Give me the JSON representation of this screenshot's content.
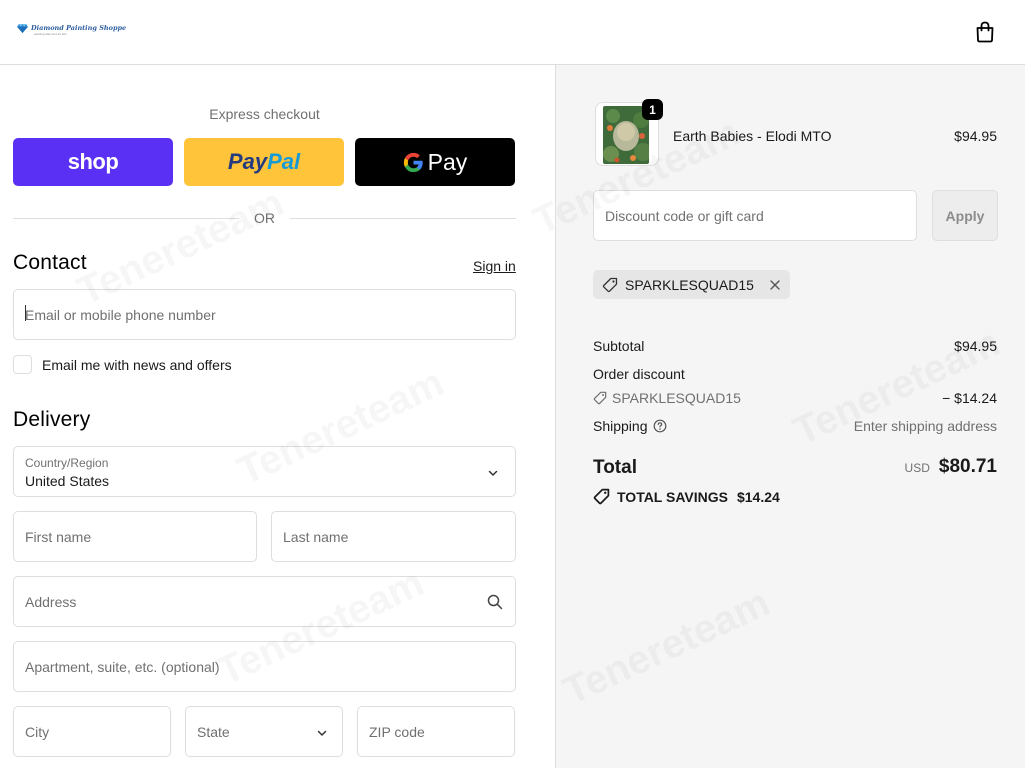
{
  "header": {
    "brand_name": "Diamond Painting Shoppe",
    "brand_tagline": "painting diamond art kits",
    "icons": {
      "brand": "diamond-icon",
      "cart": "shopping-bag-icon"
    }
  },
  "checkout": {
    "express_title": "Express checkout",
    "shop_pay_label": "shop",
    "paypal_label_1": "Pay",
    "paypal_label_2": "Pal",
    "gpay_label": "Pay",
    "or_label": "OR",
    "contact": {
      "title": "Contact",
      "sign_in": "Sign in",
      "email_placeholder": "Email or mobile phone number",
      "news_label": "Email me with news and offers",
      "news_checked": false
    },
    "delivery": {
      "title": "Delivery",
      "country_label": "Country/Region",
      "country_value": "United States",
      "first_name_placeholder": "First name",
      "last_name_placeholder": "Last name",
      "address_placeholder": "Address",
      "apartment_placeholder": "Apartment, suite, etc. (optional)",
      "city_placeholder": "City",
      "state_label": "State",
      "zip_placeholder": "ZIP code"
    }
  },
  "summary": {
    "item": {
      "name": "Earth Babies - Elodi MTO",
      "price": "$94.95",
      "quantity": "1"
    },
    "discount_placeholder": "Discount code or gift card",
    "apply_label": "Apply",
    "applied_code": "SPARKLESQUAD15",
    "subtotal_label": "Subtotal",
    "subtotal_value": "$94.95",
    "order_discount_label": "Order discount",
    "discount_code": "SPARKLESQUAD15",
    "discount_value": "− $14.24",
    "shipping_label": "Shipping",
    "shipping_value": "Enter shipping address",
    "total_label": "Total",
    "total_currency": "USD",
    "total_value": "$80.71",
    "savings_label": "TOTAL SAVINGS",
    "savings_value": "$14.24"
  },
  "colors": {
    "shop_pay": "#5a31f4",
    "paypal": "#ffc439",
    "gpay": "#000000",
    "summary_bg": "#f5f5f5",
    "border": "#dedede"
  },
  "watermark_text": "Tenereteam"
}
